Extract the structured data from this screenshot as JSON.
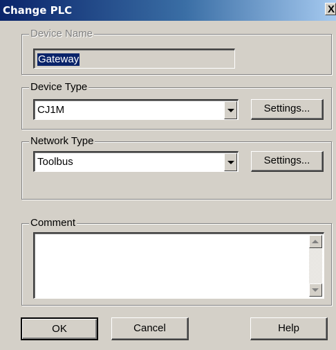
{
  "window": {
    "title": "Change PLC",
    "close_glyph": "X"
  },
  "device_name": {
    "legend": "Device Name",
    "value": "Gateway",
    "enabled": false
  },
  "device_type": {
    "legend": "Device Type",
    "selected": "CJ1M",
    "settings_label": "Settings..."
  },
  "network_type": {
    "legend": "Network Type",
    "selected": "Toolbus",
    "settings_label": "Settings..."
  },
  "comment": {
    "legend": "Comment",
    "value": ""
  },
  "footer": {
    "ok_label": "OK",
    "cancel_label": "Cancel",
    "help_label": "Help"
  },
  "icons": {
    "close": "close-icon",
    "dropdown": "chevron-down-icon",
    "scroll_up": "scroll-up-icon",
    "scroll_down": "scroll-down-icon"
  },
  "colors": {
    "face": "#d4d0c8",
    "title_start": "#0a246a",
    "title_end": "#a6caf0",
    "selection": "#0a246a"
  }
}
